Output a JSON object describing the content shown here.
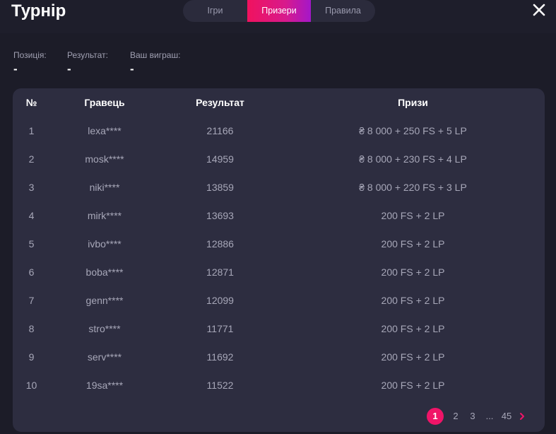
{
  "header": {
    "title": "Турнір",
    "tabs": [
      {
        "label": "Ігри"
      },
      {
        "label": "Призери"
      },
      {
        "label": "Правила"
      }
    ],
    "accent_color": "#f0125e"
  },
  "stats": {
    "position_label": "Позиція:",
    "position_value": "-",
    "result_label": "Результат:",
    "result_value": "-",
    "winnings_label": "Ваш виграш:",
    "winnings_value": "-"
  },
  "table": {
    "columns": [
      "№",
      "Гравець",
      "Результат",
      "Призи"
    ],
    "rows": [
      {
        "n": "1",
        "player": "lexa****",
        "result": "21166",
        "prize": "₴ 8 000 + 250 FS + 5 LP"
      },
      {
        "n": "2",
        "player": "mosk****",
        "result": "14959",
        "prize": "₴ 8 000 + 230 FS + 4 LP"
      },
      {
        "n": "3",
        "player": "niki****",
        "result": "13859",
        "prize": "₴ 8 000 + 220 FS + 3 LP"
      },
      {
        "n": "4",
        "player": "mirk****",
        "result": "13693",
        "prize": "200 FS + 2 LP"
      },
      {
        "n": "5",
        "player": "ivbo****",
        "result": "12886",
        "prize": "200 FS + 2 LP"
      },
      {
        "n": "6",
        "player": "boba****",
        "result": "12871",
        "prize": "200 FS + 2 LP"
      },
      {
        "n": "7",
        "player": "genn****",
        "result": "12099",
        "prize": "200 FS + 2 LP"
      },
      {
        "n": "8",
        "player": "stro****",
        "result": "11771",
        "prize": "200 FS + 2 LP"
      },
      {
        "n": "9",
        "player": "serv****",
        "result": "11692",
        "prize": "200 FS + 2 LP"
      },
      {
        "n": "10",
        "player": "19sa****",
        "result": "11522",
        "prize": "200 FS + 2 LP"
      }
    ]
  },
  "pagination": {
    "pages": [
      "1",
      "2",
      "3",
      "...",
      "45"
    ],
    "current": "1",
    "next_icon": "chevron-right-icon"
  }
}
